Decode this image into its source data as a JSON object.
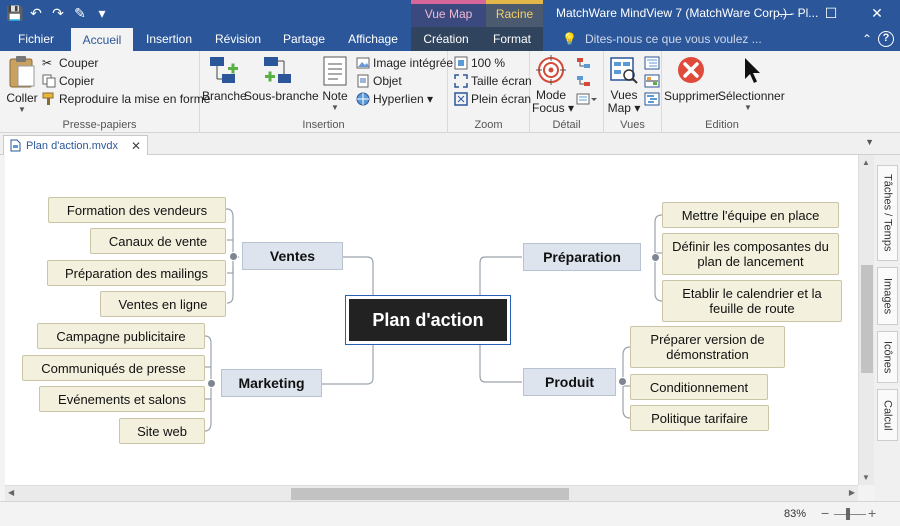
{
  "window": {
    "title": "MatchWare MindView 7 (MatchWare Corp.) - Pl...",
    "context_tabs": [
      "Vue Map",
      "Racine"
    ],
    "minimize": "—",
    "maximize": "☐",
    "close": "✕"
  },
  "qat": {
    "save": "💾",
    "undo": "↶",
    "redo": "↷",
    "extra": "✎",
    "more": "▾"
  },
  "tabs": [
    "Fichier",
    "Accueil",
    "Insertion",
    "Révision",
    "Partage",
    "Affichage",
    "Création",
    "Format"
  ],
  "tellme": {
    "icon": "💡",
    "placeholder": "Dites-nous ce que vous voulez ..."
  },
  "help": "?",
  "ribbon_collapse": "⌃",
  "ribbon": {
    "clipboard": {
      "label": "Presse-papiers",
      "paste": "Coller",
      "cut": "Couper",
      "copy": "Copier",
      "format_painter": "Reproduire la mise en forme"
    },
    "insertion": {
      "label": "Insertion",
      "branch": "Branche",
      "subbranch": "Sous-branche",
      "note": "Note",
      "image": "Image intégrée",
      "object": "Objet",
      "hyperlink": "Hyperlien ▾"
    },
    "zoom": {
      "label": "Zoom",
      "pct": "100 %",
      "fit": "Taille écran",
      "full": "Plein écran"
    },
    "detail": {
      "label": "Détail",
      "focus_mode_1": "Mode",
      "focus_mode_2": "Focus ▾"
    },
    "views": {
      "label": "Vues",
      "map_views_1": "Vues",
      "map_views_2": "Map ▾"
    },
    "edition": {
      "label": "Edition",
      "delete": "Supprimer",
      "select": "Sélectionner"
    }
  },
  "document": {
    "tab_name": "Plan d'action.mvdx",
    "close": "✕",
    "menu": "▼"
  },
  "mindmap": {
    "root": "Plan d'action",
    "ventes": {
      "title": "Ventes",
      "items": [
        "Formation des vendeurs",
        "Canaux de vente",
        "Préparation des mailings",
        "Ventes en ligne"
      ]
    },
    "marketing": {
      "title": "Marketing",
      "items": [
        "Campagne publicitaire",
        "Communiqués de presse",
        "Evénements et salons",
        "Site web"
      ]
    },
    "preparation": {
      "title": "Préparation",
      "items": [
        "Mettre l'équipe en place",
        "Définir les composantes du plan de lancement",
        "Etablir le calendrier et la feuille de route"
      ]
    },
    "produit": {
      "title": "Produit",
      "items": [
        "Préparer version de démonstration",
        "Conditionnement",
        "Politique tarifaire"
      ]
    }
  },
  "side_tabs": [
    "Tâches / Temps",
    "Images",
    "Icônes",
    "Calcul"
  ],
  "status": {
    "zoom": "83%",
    "minus": "−",
    "plus": "+"
  },
  "colors": {
    "title_bar": "#2b579a",
    "leaf_bg": "#f3f0dd",
    "branch_bg": "#dde4ed",
    "root_bg": "#222222",
    "delete_red": "#e04a3a"
  }
}
